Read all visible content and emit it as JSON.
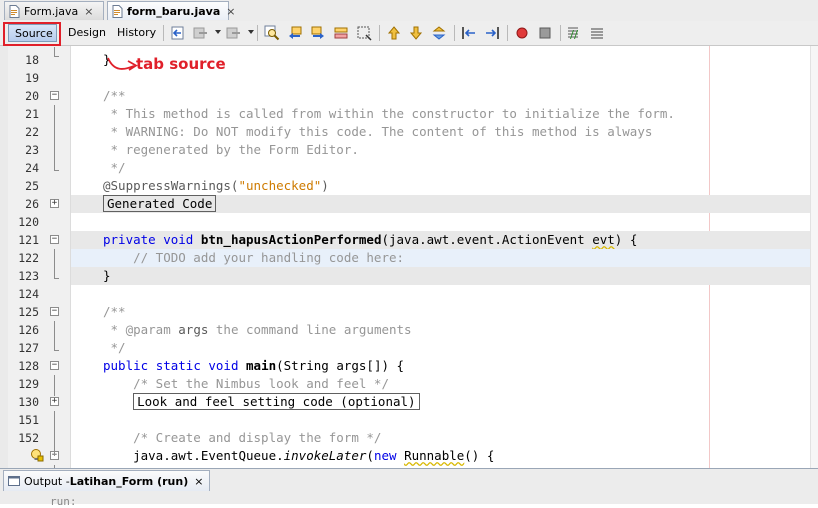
{
  "tabs": [
    {
      "label": "Form.java",
      "active": false
    },
    {
      "label": "form_baru.java",
      "active": true
    }
  ],
  "tab_close_glyph": "×",
  "toolbar": {
    "views": [
      {
        "label": "Source",
        "selected": true
      },
      {
        "label": "Design",
        "selected": false
      },
      {
        "label": "History",
        "selected": false
      }
    ],
    "icons": [
      "last-edit-icon",
      "back-icon",
      "forward-icon",
      "find-selection-icon",
      "find-previous-icon",
      "find-next-icon",
      "toggle-highlight-icon",
      "toggle-rect-select-icon",
      "previous-bookmark-icon",
      "next-bookmark-icon",
      "toggle-bookmark-icon",
      "shift-left-icon",
      "shift-right-icon",
      "start-macro-icon",
      "stop-macro-icon",
      "comment-icon",
      "uncomment-icon"
    ]
  },
  "annotation": {
    "text": "tab source",
    "color": "#e0202a"
  },
  "colors": {
    "keyword": "#0000e6",
    "comment": "#969696",
    "string": "#ce7b00",
    "accent": "#e0202a"
  },
  "editor": {
    "lines": [
      {
        "num": "18",
        "parts": [
          {
            "t": "}",
            "c": ""
          }
        ]
      },
      {
        "num": "19",
        "parts": []
      },
      {
        "num": "20",
        "parts": [
          {
            "t": "/**",
            "c": "cm"
          }
        ],
        "fold": "−"
      },
      {
        "num": "21",
        "parts": [
          {
            "t": " * This method is called from within the constructor to initialize the form.",
            "c": "cm"
          }
        ]
      },
      {
        "num": "22",
        "parts": [
          {
            "t": " * WARNING: Do NOT modify this code. The content of this method is always",
            "c": "cm"
          }
        ]
      },
      {
        "num": "23",
        "parts": [
          {
            "t": " * regenerated by the Form Editor.",
            "c": "cm"
          }
        ]
      },
      {
        "num": "24",
        "parts": [
          {
            "t": " */",
            "c": "cm"
          }
        ]
      },
      {
        "num": "25",
        "parts": [
          {
            "t": "@SuppressWarnings(",
            "c": "ann"
          },
          {
            "t": "\"unchecked\"",
            "c": "str"
          },
          {
            "t": ")",
            "c": "ann"
          }
        ]
      },
      {
        "num": "26",
        "parts": [
          {
            "t": "Generated Code",
            "c": "foldbox"
          }
        ],
        "fold": "+",
        "hl": "gray"
      },
      {
        "num": "120",
        "parts": []
      },
      {
        "num": "121",
        "parts": [
          {
            "t": "private",
            "c": "kw"
          },
          {
            "t": " ",
            "c": ""
          },
          {
            "t": "void",
            "c": "kw"
          },
          {
            "t": " ",
            "c": ""
          },
          {
            "t": "btn_hapusActionPerformed",
            "c": "bd"
          },
          {
            "t": "(java.awt.event.ActionEvent ",
            "c": ""
          },
          {
            "t": "evt",
            "c": "uline"
          },
          {
            "t": ") {",
            "c": ""
          }
        ],
        "fold": "−",
        "hl": "gray"
      },
      {
        "num": "122",
        "parts": [
          {
            "t": "    // TODO add your handling code here:",
            "c": "cm"
          }
        ],
        "hl": "blue"
      },
      {
        "num": "123",
        "parts": [
          {
            "t": "}",
            "c": ""
          }
        ],
        "hl": "gray"
      },
      {
        "num": "124",
        "parts": []
      },
      {
        "num": "125",
        "parts": [
          {
            "t": "/**",
            "c": "cm"
          }
        ],
        "fold": "−"
      },
      {
        "num": "126",
        "parts": [
          {
            "t": " * @param ",
            "c": "cm"
          },
          {
            "t": "args",
            "c": "ann"
          },
          {
            "t": " the command line arguments",
            "c": "cm"
          }
        ]
      },
      {
        "num": "127",
        "parts": [
          {
            "t": " */",
            "c": "cm"
          }
        ]
      },
      {
        "num": "128",
        "parts": [
          {
            "t": "public",
            "c": "kw"
          },
          {
            "t": " ",
            "c": ""
          },
          {
            "t": "static",
            "c": "kw"
          },
          {
            "t": " ",
            "c": ""
          },
          {
            "t": "void",
            "c": "kw"
          },
          {
            "t": " ",
            "c": ""
          },
          {
            "t": "main",
            "c": "bd"
          },
          {
            "t": "(String args[]) {",
            "c": ""
          }
        ],
        "fold": "−"
      },
      {
        "num": "129",
        "parts": [
          {
            "t": "    /* Set the Nimbus look and feel */",
            "c": "cm"
          }
        ]
      },
      {
        "num": "130",
        "parts": [
          {
            "t": "    ",
            "c": ""
          },
          {
            "t": "Look and feel setting code (optional)",
            "c": "foldbox"
          }
        ],
        "fold": "+"
      },
      {
        "num": "151",
        "parts": []
      },
      {
        "num": "152",
        "parts": [
          {
            "t": "    /* Create and display the form */",
            "c": "cm"
          }
        ]
      },
      {
        "num": "",
        "parts": [
          {
            "t": "    java.awt.EventQueue.",
            "c": ""
          },
          {
            "t": "invokeLater",
            "c": "it"
          },
          {
            "t": "(",
            "c": ""
          },
          {
            "t": "new",
            "c": "kw"
          },
          {
            "t": " ",
            "c": ""
          },
          {
            "t": "Runnable",
            "c": "uline"
          },
          {
            "t": "() {",
            "c": ""
          }
        ],
        "fold": "−",
        "hint": true
      }
    ]
  },
  "output": {
    "prefix": "Output - ",
    "title": "Latihan_Form (run)",
    "close": "×",
    "peek": "run:"
  }
}
